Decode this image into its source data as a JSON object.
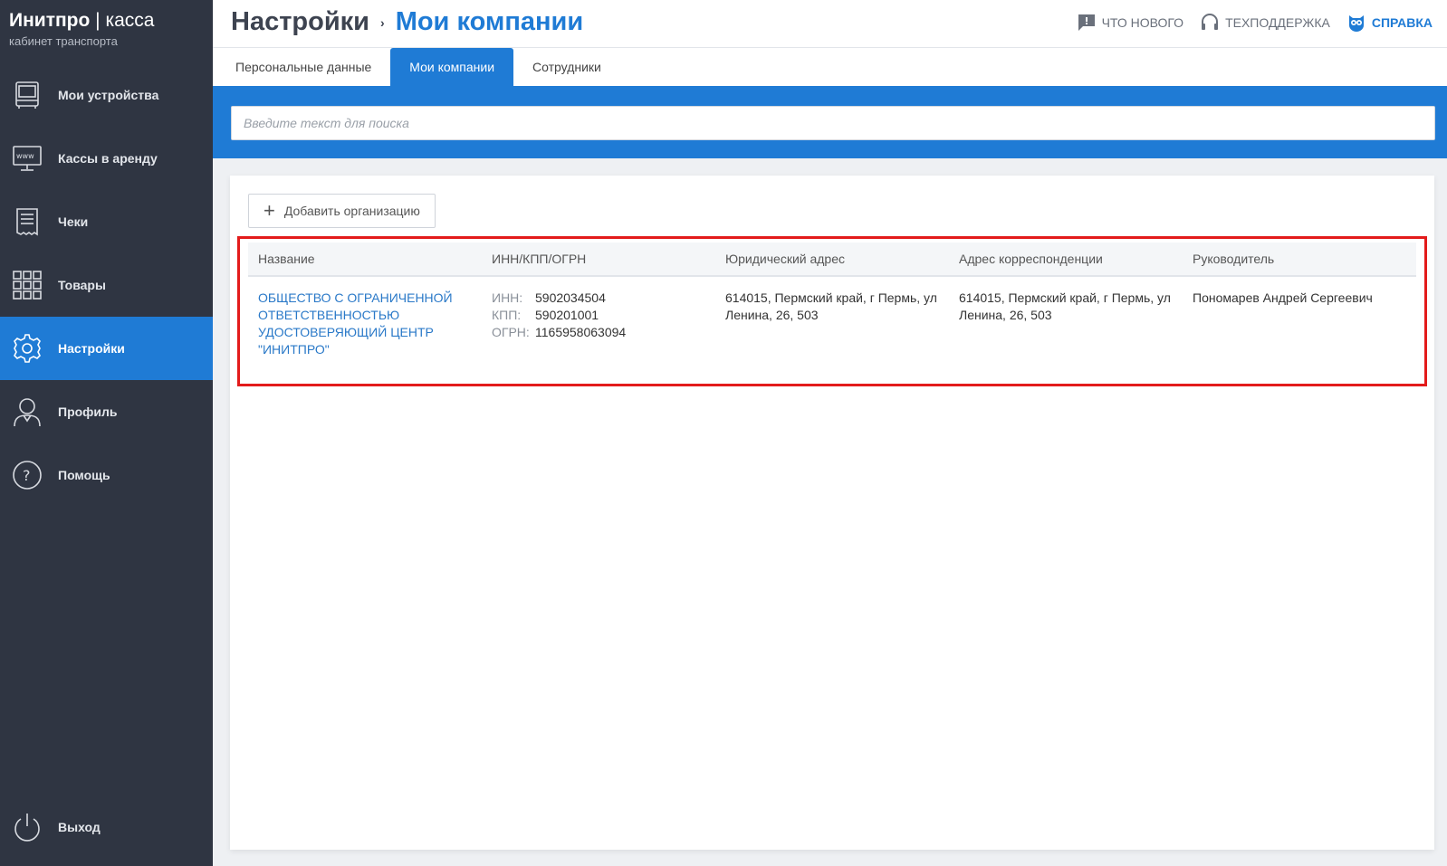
{
  "brand": {
    "name_bold": "Инитпро",
    "separator": "|",
    "name_light": "касса",
    "subtitle": "кабинет транспорта"
  },
  "sidebar": {
    "items": [
      {
        "label": "Мои устройства",
        "icon": "bus-icon"
      },
      {
        "label": "Кассы в аренду",
        "icon": "www-monitor-icon"
      },
      {
        "label": "Чеки",
        "icon": "receipt-icon"
      },
      {
        "label": "Товары",
        "icon": "grid-icon"
      },
      {
        "label": "Настройки",
        "icon": "gear-icon",
        "active": true
      },
      {
        "label": "Профиль",
        "icon": "user-icon"
      },
      {
        "label": "Помощь",
        "icon": "help-icon"
      }
    ],
    "logout": {
      "label": "Выход",
      "icon": "power-icon"
    }
  },
  "header": {
    "breadcrumb_root": "Настройки",
    "breadcrumb_sep": "›",
    "breadcrumb_current": "Мои компании",
    "links": {
      "whats_new": "Что нового",
      "support": "Техподдержка",
      "help": "Справка"
    }
  },
  "tabs": [
    {
      "label": "Персональные данные"
    },
    {
      "label": "Мои компании",
      "active": true
    },
    {
      "label": "Сотрудники"
    }
  ],
  "search": {
    "placeholder": "Введите текст для поиска",
    "value": ""
  },
  "toolbar": {
    "add_label": "Добавить организацию"
  },
  "table": {
    "headers": [
      "Название",
      "ИНН/КПП/ОГРН",
      "Юридический адрес",
      "Адрес корреспонденции",
      "Руководитель"
    ],
    "rows": [
      {
        "name": "ОБЩЕСТВО С ОГРАНИЧЕННОЙ ОТВЕТСТВЕННОСТЬЮ УДОСТОВЕРЯЮЩИЙ ЦЕНТР \"ИНИТПРО\"",
        "inn_label": "ИНН:",
        "inn": "5902034504",
        "kpp_label": "КПП:",
        "kpp": "590201001",
        "ogrn_label": "ОГРН:",
        "ogrn": "1165958063094",
        "legal_address": "614015, Пермский край, г Пермь, ул Ленина, 26, 503",
        "mail_address": "614015, Пермский край, г Пермь, ул Ленина, 26, 503",
        "director": "Пономарев Андрей Сергеевич"
      }
    ]
  },
  "colors": {
    "sidebar_bg": "#2f3542",
    "accent": "#1f7bd5",
    "highlight": "#e31b1b"
  }
}
